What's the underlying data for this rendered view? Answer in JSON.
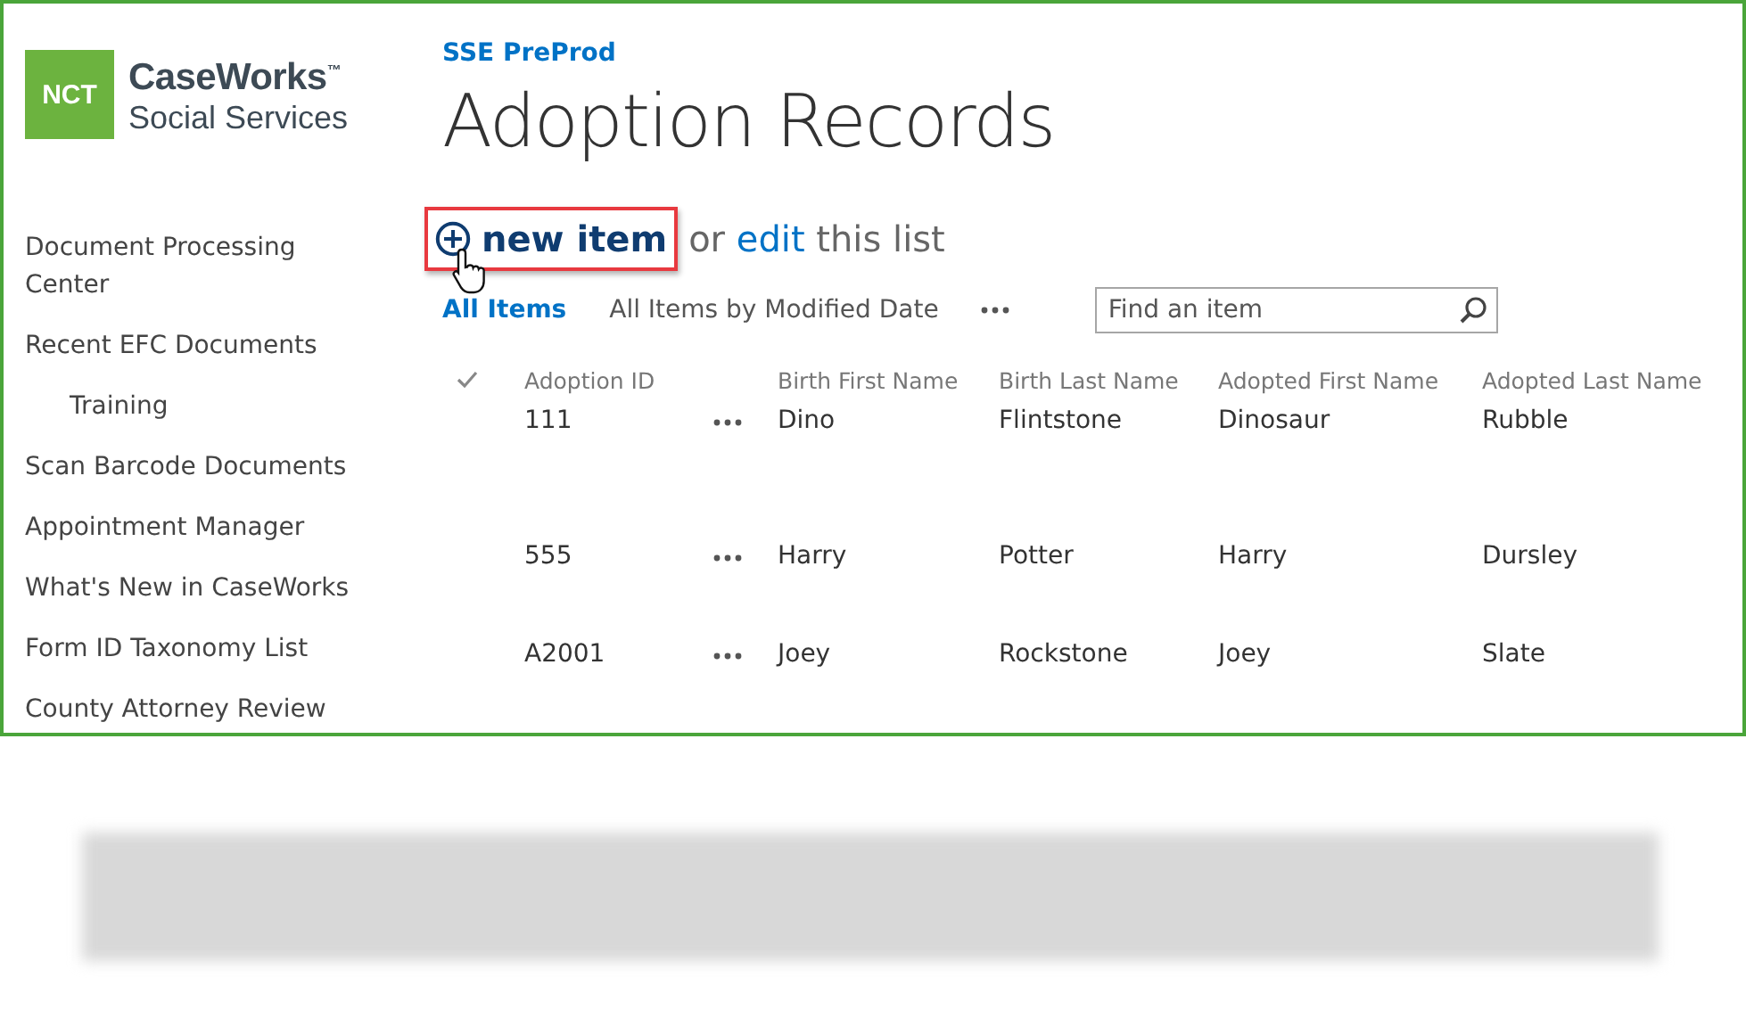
{
  "logo": {
    "badge": "NCT",
    "name": "CaseWorks$^{™}$",
    "subtitle": "Social Services"
  },
  "sidebar": {
    "items": [
      {
        "label": "Document Processing Center"
      },
      {
        "label": "Recent EFC Documents",
        "children": [
          {
            "label": "Training"
          }
        ]
      },
      {
        "label": "Scan Barcode Documents"
      },
      {
        "label": "Appointment Manager"
      },
      {
        "label": "What's New in CaseWorks"
      },
      {
        "label": "Form ID Taxonomy List"
      },
      {
        "label": "County Attorney Review"
      }
    ]
  },
  "site": {
    "title": "SSE PreProd"
  },
  "page_title": "Adoption Records",
  "command": {
    "new_item": "new item",
    "connector": "or",
    "edit_link": "edit",
    "tail": "this list"
  },
  "views": [
    {
      "label": "All Items",
      "selected": true
    },
    {
      "label": "All Items by Modified Date",
      "selected": false
    }
  ],
  "search": {
    "placeholder": "Find an item"
  },
  "table": {
    "columns": [
      "Adoption ID",
      "Birth First Name",
      "Birth Last Name",
      "Adopted First Name",
      "Adopted Last Name"
    ],
    "rows": [
      {
        "cells": [
          "111",
          "Dino",
          "Flintstone",
          "Dinosaur",
          "Rubble"
        ]
      },
      {
        "cells": [
          "555",
          "Harry",
          "Potter",
          "Harry",
          "Dursley"
        ]
      },
      {
        "cells": [
          "A2001",
          "Joey",
          "Rockstone",
          "Joey",
          "Slate"
        ]
      }
    ]
  }
}
